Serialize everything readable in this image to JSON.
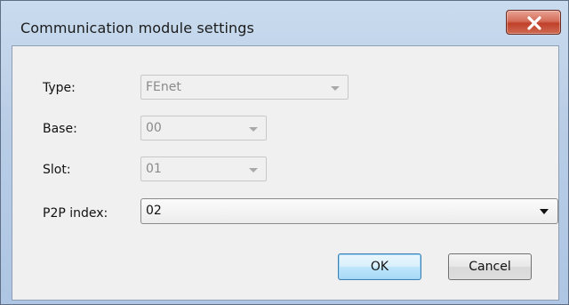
{
  "window": {
    "title": "Communication module settings",
    "close_glyph": "x"
  },
  "form": {
    "type": {
      "label": "Type:",
      "value": "FEnet",
      "enabled": false
    },
    "base": {
      "label": "Base:",
      "value": "00",
      "enabled": false
    },
    "slot": {
      "label": "Slot:",
      "value": "01",
      "enabled": false
    },
    "p2p_index": {
      "label": "P2P index:",
      "value": "02",
      "enabled": true
    }
  },
  "buttons": {
    "ok": "OK",
    "cancel": "Cancel"
  }
}
